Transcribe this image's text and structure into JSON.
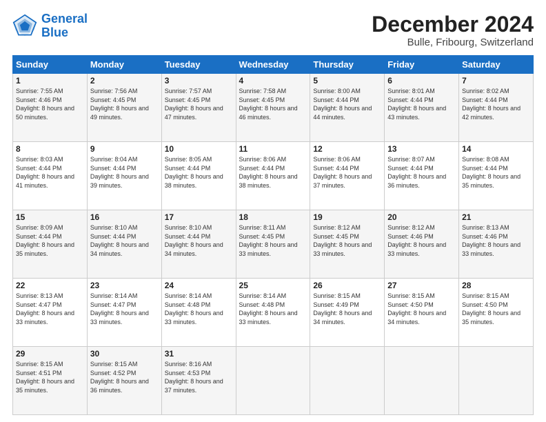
{
  "header": {
    "logo_line1": "General",
    "logo_line2": "Blue",
    "title": "December 2024",
    "subtitle": "Bulle, Fribourg, Switzerland"
  },
  "weekdays": [
    "Sunday",
    "Monday",
    "Tuesday",
    "Wednesday",
    "Thursday",
    "Friday",
    "Saturday"
  ],
  "weeks": [
    [
      {
        "day": "1",
        "sunrise": "7:55 AM",
        "sunset": "4:46 PM",
        "daylight": "8 hours and 50 minutes."
      },
      {
        "day": "2",
        "sunrise": "7:56 AM",
        "sunset": "4:45 PM",
        "daylight": "8 hours and 49 minutes."
      },
      {
        "day": "3",
        "sunrise": "7:57 AM",
        "sunset": "4:45 PM",
        "daylight": "8 hours and 47 minutes."
      },
      {
        "day": "4",
        "sunrise": "7:58 AM",
        "sunset": "4:45 PM",
        "daylight": "8 hours and 46 minutes."
      },
      {
        "day": "5",
        "sunrise": "8:00 AM",
        "sunset": "4:44 PM",
        "daylight": "8 hours and 44 minutes."
      },
      {
        "day": "6",
        "sunrise": "8:01 AM",
        "sunset": "4:44 PM",
        "daylight": "8 hours and 43 minutes."
      },
      {
        "day": "7",
        "sunrise": "8:02 AM",
        "sunset": "4:44 PM",
        "daylight": "8 hours and 42 minutes."
      }
    ],
    [
      {
        "day": "8",
        "sunrise": "8:03 AM",
        "sunset": "4:44 PM",
        "daylight": "8 hours and 41 minutes."
      },
      {
        "day": "9",
        "sunrise": "8:04 AM",
        "sunset": "4:44 PM",
        "daylight": "8 hours and 39 minutes."
      },
      {
        "day": "10",
        "sunrise": "8:05 AM",
        "sunset": "4:44 PM",
        "daylight": "8 hours and 38 minutes."
      },
      {
        "day": "11",
        "sunrise": "8:06 AM",
        "sunset": "4:44 PM",
        "daylight": "8 hours and 38 minutes."
      },
      {
        "day": "12",
        "sunrise": "8:06 AM",
        "sunset": "4:44 PM",
        "daylight": "8 hours and 37 minutes."
      },
      {
        "day": "13",
        "sunrise": "8:07 AM",
        "sunset": "4:44 PM",
        "daylight": "8 hours and 36 minutes."
      },
      {
        "day": "14",
        "sunrise": "8:08 AM",
        "sunset": "4:44 PM",
        "daylight": "8 hours and 35 minutes."
      }
    ],
    [
      {
        "day": "15",
        "sunrise": "8:09 AM",
        "sunset": "4:44 PM",
        "daylight": "8 hours and 35 minutes."
      },
      {
        "day": "16",
        "sunrise": "8:10 AM",
        "sunset": "4:44 PM",
        "daylight": "8 hours and 34 minutes."
      },
      {
        "day": "17",
        "sunrise": "8:10 AM",
        "sunset": "4:44 PM",
        "daylight": "8 hours and 34 minutes."
      },
      {
        "day": "18",
        "sunrise": "8:11 AM",
        "sunset": "4:45 PM",
        "daylight": "8 hours and 33 minutes."
      },
      {
        "day": "19",
        "sunrise": "8:12 AM",
        "sunset": "4:45 PM",
        "daylight": "8 hours and 33 minutes."
      },
      {
        "day": "20",
        "sunrise": "8:12 AM",
        "sunset": "4:46 PM",
        "daylight": "8 hours and 33 minutes."
      },
      {
        "day": "21",
        "sunrise": "8:13 AM",
        "sunset": "4:46 PM",
        "daylight": "8 hours and 33 minutes."
      }
    ],
    [
      {
        "day": "22",
        "sunrise": "8:13 AM",
        "sunset": "4:47 PM",
        "daylight": "8 hours and 33 minutes."
      },
      {
        "day": "23",
        "sunrise": "8:14 AM",
        "sunset": "4:47 PM",
        "daylight": "8 hours and 33 minutes."
      },
      {
        "day": "24",
        "sunrise": "8:14 AM",
        "sunset": "4:48 PM",
        "daylight": "8 hours and 33 minutes."
      },
      {
        "day": "25",
        "sunrise": "8:14 AM",
        "sunset": "4:48 PM",
        "daylight": "8 hours and 33 minutes."
      },
      {
        "day": "26",
        "sunrise": "8:15 AM",
        "sunset": "4:49 PM",
        "daylight": "8 hours and 34 minutes."
      },
      {
        "day": "27",
        "sunrise": "8:15 AM",
        "sunset": "4:50 PM",
        "daylight": "8 hours and 34 minutes."
      },
      {
        "day": "28",
        "sunrise": "8:15 AM",
        "sunset": "4:50 PM",
        "daylight": "8 hours and 35 minutes."
      }
    ],
    [
      {
        "day": "29",
        "sunrise": "8:15 AM",
        "sunset": "4:51 PM",
        "daylight": "8 hours and 35 minutes."
      },
      {
        "day": "30",
        "sunrise": "8:15 AM",
        "sunset": "4:52 PM",
        "daylight": "8 hours and 36 minutes."
      },
      {
        "day": "31",
        "sunrise": "8:16 AM",
        "sunset": "4:53 PM",
        "daylight": "8 hours and 37 minutes."
      },
      null,
      null,
      null,
      null
    ]
  ]
}
